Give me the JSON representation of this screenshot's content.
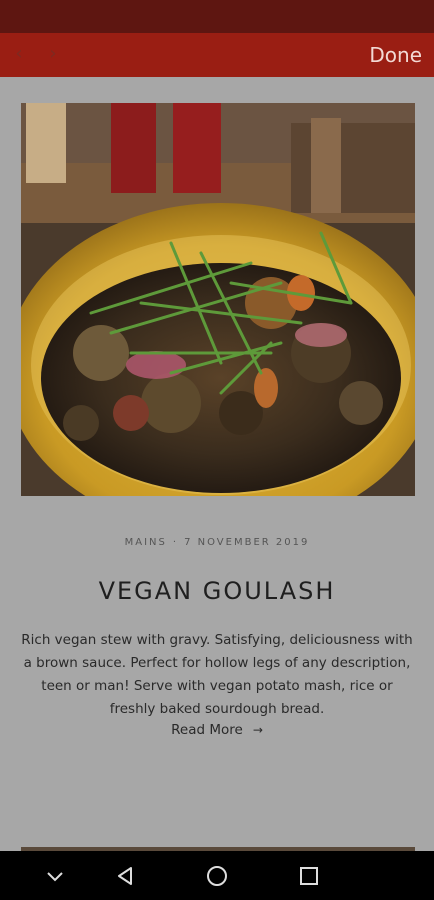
{
  "toolbar": {
    "back_glyph": "‹",
    "forward_glyph": "›",
    "done_label": "Done"
  },
  "post": {
    "category": "MAINS",
    "separator": "·",
    "date": "7 NOVEMBER 2019",
    "title": "VEGAN GOULASH",
    "excerpt": "Rich vegan stew with gravy.  Satisfying, deliciousness with a brown sauce.  Perfect for hollow legs of any description, teen or man!  Serve with vegan potato mash, rice or freshly baked sourdough bread.",
    "read_more": "Read More",
    "read_more_arrow": "→"
  },
  "colors": {
    "status_bar": "#5e1611",
    "toolbar": "#9a1e13",
    "page_bg": "#a7a7a7",
    "nav_bar": "#000000"
  },
  "icons": [
    "chevron-down-icon",
    "back-triangle-icon",
    "home-circle-icon",
    "recents-square-icon"
  ]
}
